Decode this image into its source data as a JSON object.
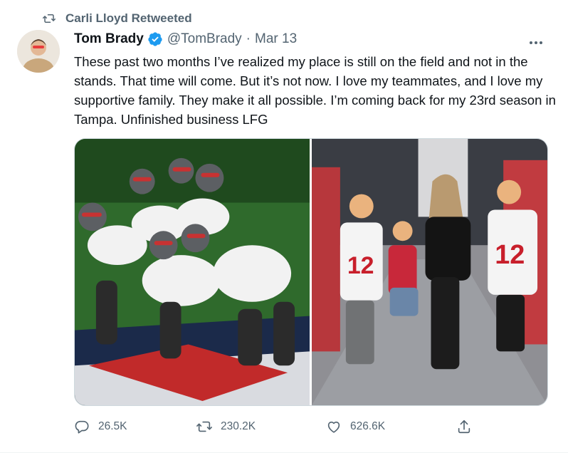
{
  "social_context": {
    "text": "Carli Lloyd Retweeted",
    "icon": "retweet-icon"
  },
  "author": {
    "name": "Tom Brady",
    "handle": "@TomBrady",
    "separator": "·",
    "date": "Mar 13",
    "verified": true
  },
  "tweet": {
    "text": "These past two months I’ve realized my place is still on the field and not in the stands. That time will come. But it’s not now. I love my teammates, and I love my supportive family. They make it all possible. I’m coming back for my 23rd season in Tampa. Unfinished business LFG"
  },
  "media": [
    {
      "icon": "football-players-photo"
    },
    {
      "icon": "family-photo"
    }
  ],
  "actions": {
    "replies": "26.5K",
    "retweets": "230.2K",
    "likes": "626.6K"
  },
  "colors": {
    "secondary_text": "#536471",
    "primary_text": "#0f1419",
    "verified_blue": "#1d9bf0",
    "border": "#cfd9de"
  }
}
